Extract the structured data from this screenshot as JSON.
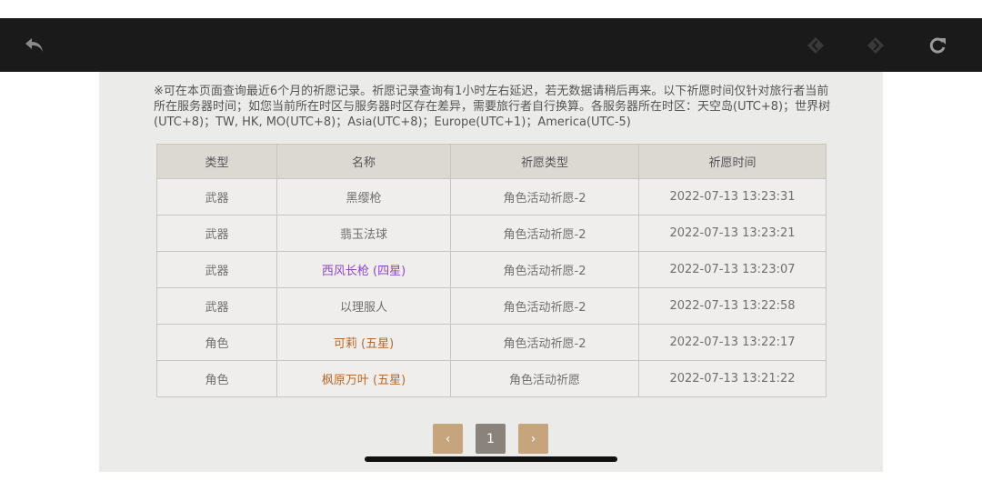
{
  "toolbar": {
    "back_icon": "back-arrow-icon",
    "prev_icon": "diamond-prev-icon",
    "next_icon": "diamond-next-icon",
    "refresh_icon": "refresh-icon"
  },
  "notice": "※可在本页面查询最近6个月的祈愿记录。祈愿记录查询有1小时左右延迟，若无数据请稍后再来。以下祈愿时间仅针对旅行者当前所在服务器时间；如您当前所在时区与服务器时区存在差异，需要旅行者自行换算。各服务器所在时区：天空岛(UTC+8)；世界树(UTC+8)；TW, HK, MO(UTC+8)；Asia(UTC+8)；Europe(UTC+1)；America(UTC-5)",
  "table": {
    "headers": [
      "类型",
      "名称",
      "祈愿类型",
      "祈愿时间"
    ],
    "rows": [
      {
        "type": "武器",
        "name": "黑缨枪",
        "wish_type": "角色活动祈愿-2",
        "time": "2022-07-13 13:23:31"
      },
      {
        "type": "武器",
        "name": "翡玉法球",
        "wish_type": "角色活动祈愿-2",
        "time": "2022-07-13 13:23:21"
      },
      {
        "type": "武器",
        "name": "西风长枪 (四星)",
        "wish_type": "角色活动祈愿-2",
        "time": "2022-07-13 13:23:07"
      },
      {
        "type": "武器",
        "name": "以理服人",
        "wish_type": "角色活动祈愿-2",
        "time": "2022-07-13 13:22:58"
      },
      {
        "type": "角色",
        "name": "可莉 (五星)",
        "wish_type": "角色活动祈愿-2",
        "time": "2022-07-13 13:22:17"
      },
      {
        "type": "角色",
        "name": "枫原万叶 (五星)",
        "wish_type": "角色活动祈愿",
        "time": "2022-07-13 13:21:22"
      }
    ]
  },
  "colors": {
    "four_star": "#9046c5",
    "five_star": "#b7682a",
    "pager_button": "#c6a57d",
    "pager_current": "#8a837b"
  },
  "pager": {
    "prev": "‹",
    "current": "1",
    "next": "›"
  }
}
